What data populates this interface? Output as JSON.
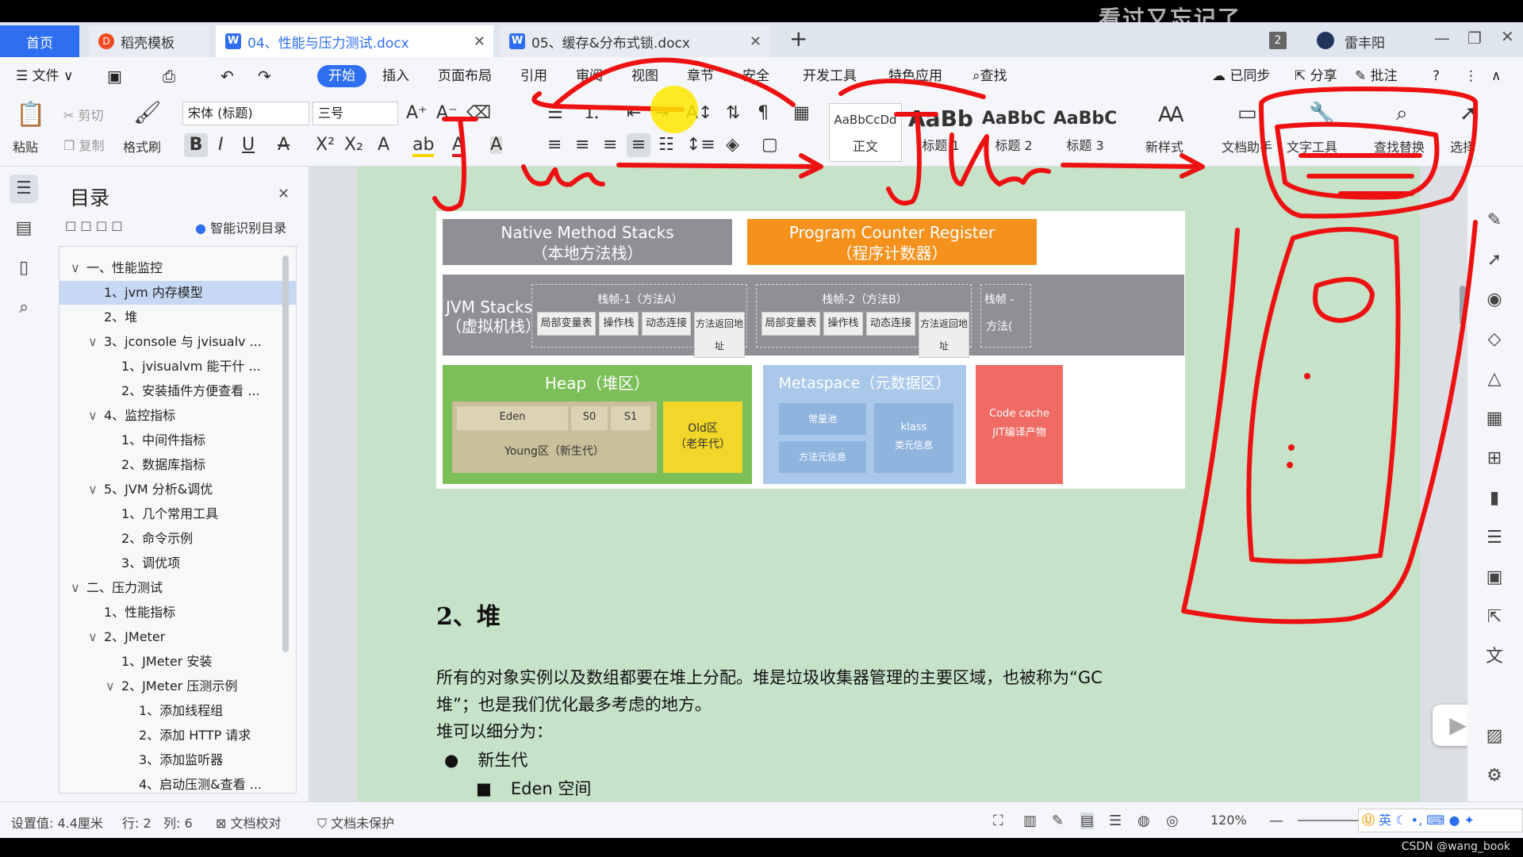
{
  "watermark": "看过又忘记了",
  "tabs": [
    {
      "label": "首页"
    },
    {
      "label": "稻壳模板"
    },
    {
      "label": "04、性能与压力测试.docx"
    },
    {
      "label": "05、缓存&分布式锁.docx"
    }
  ],
  "titlebar": {
    "badge": "2",
    "user": "雷丰阳"
  },
  "menu": {
    "file": "文件",
    "items": [
      "开始",
      "插入",
      "页面布局",
      "引用",
      "审阅",
      "视图",
      "章节",
      "安全",
      "开发工具",
      "特色应用"
    ],
    "search": "查找",
    "sync": "已同步",
    "share": "分享",
    "comment": "批注"
  },
  "ribbon": {
    "paste": "粘贴",
    "cut": "剪切",
    "copy": "复制",
    "format_painter": "格式刷",
    "font": "宋体 (标题)",
    "size": "三号",
    "styles": [
      {
        "preview": "AaBbCcDd",
        "label": "正文"
      },
      {
        "preview": "AaBb",
        "label": "标题 1"
      },
      {
        "preview": "AaBbC",
        "label": "标题 2"
      },
      {
        "preview": "AaBbC",
        "label": "标题 3"
      }
    ],
    "new_style": "新样式",
    "doc_helper": "文档助手",
    "text_tools": "文字工具",
    "find_replace": "查找替换",
    "select": "选择"
  },
  "toc": {
    "title": "目录",
    "smart": "智能识别目录",
    "items": [
      {
        "text": "一、性能监控",
        "level": 0,
        "arrow": "∨"
      },
      {
        "text": "1、jvm 内存模型",
        "level": 1,
        "arrow": "",
        "active": true
      },
      {
        "text": "2、堆",
        "level": 1,
        "arrow": ""
      },
      {
        "text": "3、jconsole 与 jvisualv ...",
        "level": 1,
        "arrow": "∨"
      },
      {
        "text": "1、jvisualvm 能干什 ...",
        "level": 2,
        "arrow": ""
      },
      {
        "text": "2、安装插件方便查看 ...",
        "level": 2,
        "arrow": ""
      },
      {
        "text": "4、监控指标",
        "level": 1,
        "arrow": "∨"
      },
      {
        "text": "1、中间件指标",
        "level": 2,
        "arrow": ""
      },
      {
        "text": "2、数据库指标",
        "level": 2,
        "arrow": ""
      },
      {
        "text": "5、JVM 分析&调优",
        "level": 1,
        "arrow": "∨"
      },
      {
        "text": "1、几个常用工具",
        "level": 2,
        "arrow": ""
      },
      {
        "text": "2、命令示例",
        "level": 2,
        "arrow": ""
      },
      {
        "text": "3、调优项",
        "level": 2,
        "arrow": ""
      },
      {
        "text": "二、压力测试",
        "level": 0,
        "arrow": "∨"
      },
      {
        "text": "1、性能指标",
        "level": 1,
        "arrow": ""
      },
      {
        "text": "2、JMeter",
        "level": 1,
        "arrow": "∨"
      },
      {
        "text": "1、JMeter 安装",
        "level": 2,
        "arrow": ""
      },
      {
        "text": "2、JMeter 压测示例",
        "level": 2,
        "arrow": "∨"
      },
      {
        "text": "1、添加线程组",
        "level": 3,
        "arrow": ""
      },
      {
        "text": "2、添加 HTTP 请求",
        "level": 3,
        "arrow": ""
      },
      {
        "text": "3、添加监听器",
        "level": 3,
        "arrow": ""
      },
      {
        "text": "4、启动压测&查看 ...",
        "level": 3,
        "arrow": ""
      }
    ]
  },
  "diagram": {
    "native": [
      "Native Method Stacks",
      "（本地方法栈）"
    ],
    "pcr": [
      "Program Counter Register",
      "（程序计数器）"
    ],
    "jvmstacks": [
      "JVM Stacks",
      "（虚拟机栈）"
    ],
    "frame1": "栈帧-1（方法A）",
    "frame2": "栈帧-2（方法B）",
    "frame3": "栈帧 -",
    "frame_items": [
      "局部变量表",
      "操作栈",
      "动态连接",
      "方法返回地址"
    ],
    "frame3_item": "方法(",
    "heap": "Heap（堆区）",
    "eden": "Eden",
    "s0": "S0",
    "s1": "S1",
    "young": "Young区（新生代）",
    "old": [
      "Old区",
      "（老年代）"
    ],
    "meta": "Metaspace（元数据区）",
    "pool": "常量池",
    "klass": "klass",
    "klass2": "类元信息",
    "methodinfo": "方法元信息",
    "codecache": [
      "Code cache",
      "JIT编译产物"
    ]
  },
  "doc": {
    "heading": "2、堆",
    "p1": "所有的对象实例以及数组都要在堆上分配。堆是垃圾收集器管理的主要区域，也被称为“GC",
    "p2": "堆”；也是我们优化最多考虑的地方。",
    "p3": "堆可以细分为：",
    "b1": "新生代",
    "b2": "Eden 空间"
  },
  "status": {
    "setting": "设置值: 4.4厘米",
    "row": "行: 2",
    "col": "列: 6",
    "proof": "文档校对",
    "protect": "文档未保护",
    "zoom": "120%",
    "ime": "英",
    "csdn": "CSDN @wang_book"
  }
}
